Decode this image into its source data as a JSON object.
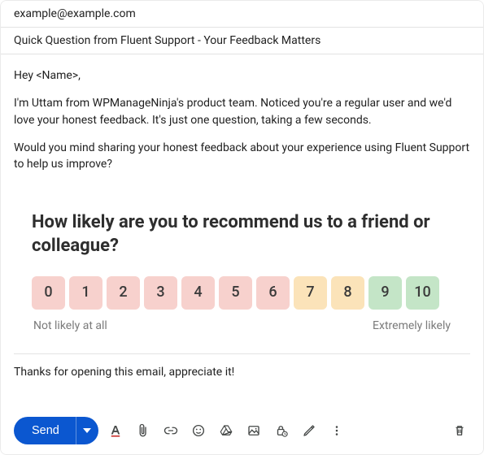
{
  "to": "example@example.com",
  "subject": "Quick Question from Fluent Support - Your Feedback Matters",
  "body": {
    "greeting": "Hey <Name>,",
    "p1": "I'm Uttam from WPManageNinja's product team. Noticed you're a regular user and we'd love your honest feedback. It's just one question, taking a few seconds.",
    "p2": "Would you mind sharing your honest feedback about your experience using Fluent Support to help us improve?",
    "closing": "Thanks for opening this email, appreciate it!"
  },
  "nps": {
    "question": "How likely are you to recommend us to a friend or colleague?",
    "scale": [
      {
        "n": "0",
        "c": "red"
      },
      {
        "n": "1",
        "c": "red"
      },
      {
        "n": "2",
        "c": "red"
      },
      {
        "n": "3",
        "c": "red"
      },
      {
        "n": "4",
        "c": "red"
      },
      {
        "n": "5",
        "c": "red"
      },
      {
        "n": "6",
        "c": "red"
      },
      {
        "n": "7",
        "c": "amber"
      },
      {
        "n": "8",
        "c": "amber"
      },
      {
        "n": "9",
        "c": "green"
      },
      {
        "n": "10",
        "c": "green"
      }
    ],
    "anchor_low": "Not likely at all",
    "anchor_high": "Extremely likely"
  },
  "toolbar": {
    "send_label": "Send"
  }
}
